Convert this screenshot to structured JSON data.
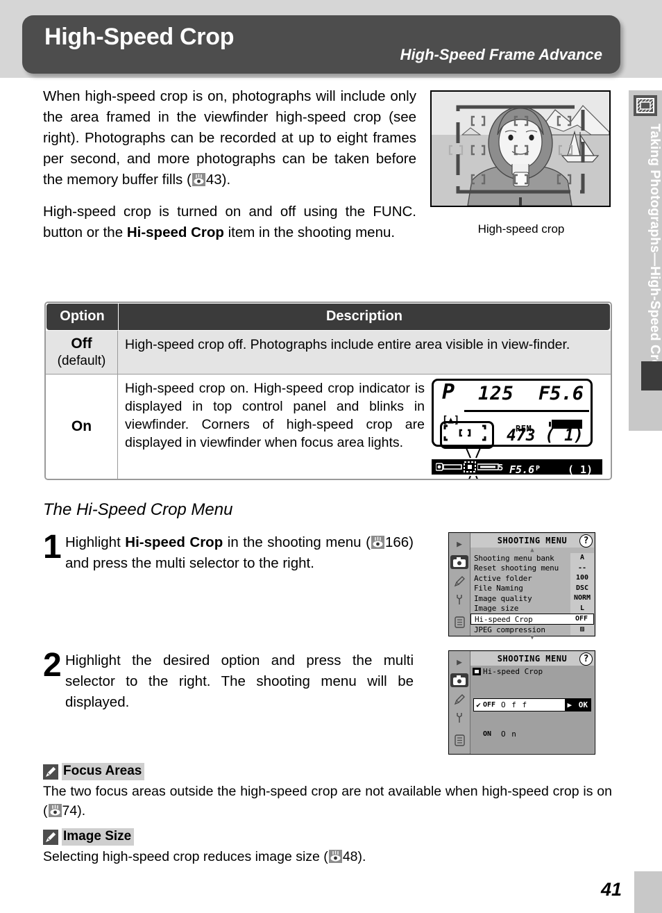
{
  "header": {
    "title": "High-Speed Crop",
    "subtitle": "High-Speed Frame Advance"
  },
  "side_tab": {
    "label": "Taking Photographs—High-Speed Crop",
    "icon": "crop-frame-icon"
  },
  "intro": {
    "paragraph1_a": "When high-speed crop is on, photographs will include only the area framed in the viewfinder high-speed crop (see right).  Photographs can be recorded at up to eight frames per second, and more photographs can be taken before the memory buffer fills (",
    "paragraph1_ref": "43",
    "paragraph1_b": ").",
    "paragraph2_a": "High-speed crop is turned on and off using the FUNC. button or the ",
    "paragraph2_bold": "Hi-speed Crop",
    "paragraph2_b": " item in the shooting menu."
  },
  "viewfinder_figure": {
    "caption": "High-speed crop"
  },
  "table": {
    "headers": [
      "Option",
      "Description"
    ],
    "rows": [
      {
        "option": "Off",
        "option_sub": "(default)",
        "description": "High-speed crop off.  Photographs include entire area visible in view-finder."
      },
      {
        "option": "On",
        "option_sub": "",
        "description": "High-speed crop on.  High-speed crop indicator is displayed in top control panel and blinks in viewfinder.  Corners of high-speed crop are displayed in viewfinder when focus area lights."
      }
    ]
  },
  "lcd_panel": {
    "mode": "P",
    "shutter_speed": "125",
    "aperture": "F5.6",
    "remaining_label": "REM",
    "remaining": "473",
    "buffer": "( 1)"
  },
  "viewfinder_strip": {
    "aperture": "F5.6",
    "mode": "P",
    "frames": "( 1)"
  },
  "menu_section": {
    "subhead": "The Hi-Speed Crop Menu",
    "steps": [
      {
        "num": "1",
        "text_a": "Highlight ",
        "text_bold": "Hi-speed Crop",
        "text_b": " in the shooting menu (",
        "ref": "166",
        "text_c": ") and press the multi selector to the right."
      },
      {
        "num": "2",
        "text_a": "Highlight the desired option and press the multi selector to the right.  The shooting menu will be displayed.",
        "text_bold": "",
        "text_b": "",
        "ref": "",
        "text_c": ""
      }
    ]
  },
  "camera_menu_1": {
    "title": "SHOOTING MENU",
    "help_icon": "?",
    "scroll_up": "▲",
    "scroll_down": "▼",
    "rail_icons": [
      "playback-icon",
      "camera-icon",
      "pencil-icon",
      "wrench-icon",
      "list-icon"
    ],
    "items": [
      {
        "label": "Shooting menu bank",
        "value": "A",
        "highlighted": false
      },
      {
        "label": "Reset shooting menu",
        "value": "--",
        "highlighted": false
      },
      {
        "label": "Active folder",
        "value": "100",
        "highlighted": false
      },
      {
        "label": "File Naming",
        "value": "DSC",
        "highlighted": false
      },
      {
        "label": "Image quality",
        "value": "NORM",
        "highlighted": false
      },
      {
        "label": "Image size",
        "value": "L",
        "highlighted": false
      },
      {
        "label": "Hi-speed Crop",
        "value": "OFF",
        "highlighted": true
      },
      {
        "label": "JPEG compression",
        "value": "▨",
        "highlighted": false
      }
    ]
  },
  "camera_menu_2": {
    "title": "SHOOTING MENU",
    "help_icon": "?",
    "sub_title": "Hi-speed Crop",
    "options": [
      {
        "check": "✔",
        "code": "OFF",
        "name": "O f f",
        "ok": "OK",
        "selected": true
      },
      {
        "check": "",
        "code": "ON",
        "name": "O n",
        "ok": "",
        "selected": false
      }
    ]
  },
  "notes": [
    {
      "title": "Focus Areas",
      "body_a": "The two focus areas outside the high-speed crop are not available when high-speed crop is on (",
      "ref": "74",
      "body_b": ")."
    },
    {
      "title": "Image Size",
      "body_a": "Selecting high-speed crop reduces image size (",
      "ref": "48",
      "body_b": ")."
    }
  ],
  "page_number": "41",
  "colors": {
    "header_band": "#d6d6d6",
    "header_box": "#4d4d4d",
    "table_head": "#3b3b3b",
    "row_off": "#e4e4e4",
    "side_tab": "#c8c8c8"
  }
}
